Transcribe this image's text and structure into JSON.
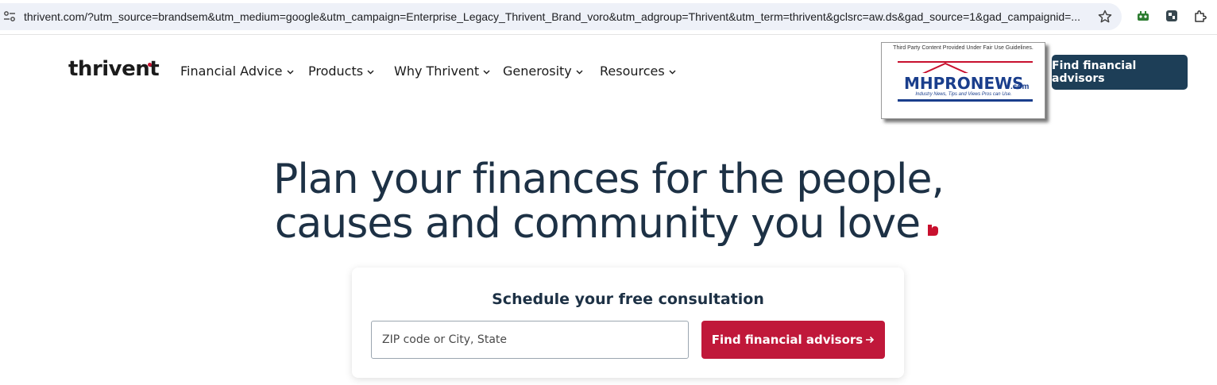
{
  "browser": {
    "url": "thrivent.com/?utm_source=brandsem&utm_medium=google&utm_campaign=Enterprise_Legacy_Thrivent_Brand_voro&utm_adgroup=Thrivent&utm_term=thrivent&gclsrc=aw.ds&gad_source=1&gad_campaignid=...",
    "icons": [
      "site-info-icon",
      "star-icon",
      "extension-icon",
      "extension-icon",
      "puzzle-icon"
    ]
  },
  "header": {
    "logo": "thrivent",
    "nav": [
      {
        "label": "Financial Advice"
      },
      {
        "label": "Products"
      },
      {
        "label": "Why Thrivent"
      },
      {
        "label": "Generosity"
      },
      {
        "label": "Resources"
      }
    ],
    "cta_label": "Find financial advisors"
  },
  "watermark": {
    "caption": "Third Party Content Provided Under Fair Use Guidelines.",
    "brand": "MHPRONEWS",
    "domain": ".com",
    "tagline": "Industry News, Tips and Views Pros can Use."
  },
  "hero": {
    "line1": "Plan your finances for the people,",
    "line2": "causes and community you love"
  },
  "consultation": {
    "title": "Schedule your free consultation",
    "input_placeholder": "ZIP code or City, State",
    "button_label": "Find financial advisors"
  },
  "colors": {
    "navy": "#1d3e57",
    "heading": "#1d3145",
    "brand_red": "#c0183a",
    "omnibox": "#eef1f8"
  }
}
